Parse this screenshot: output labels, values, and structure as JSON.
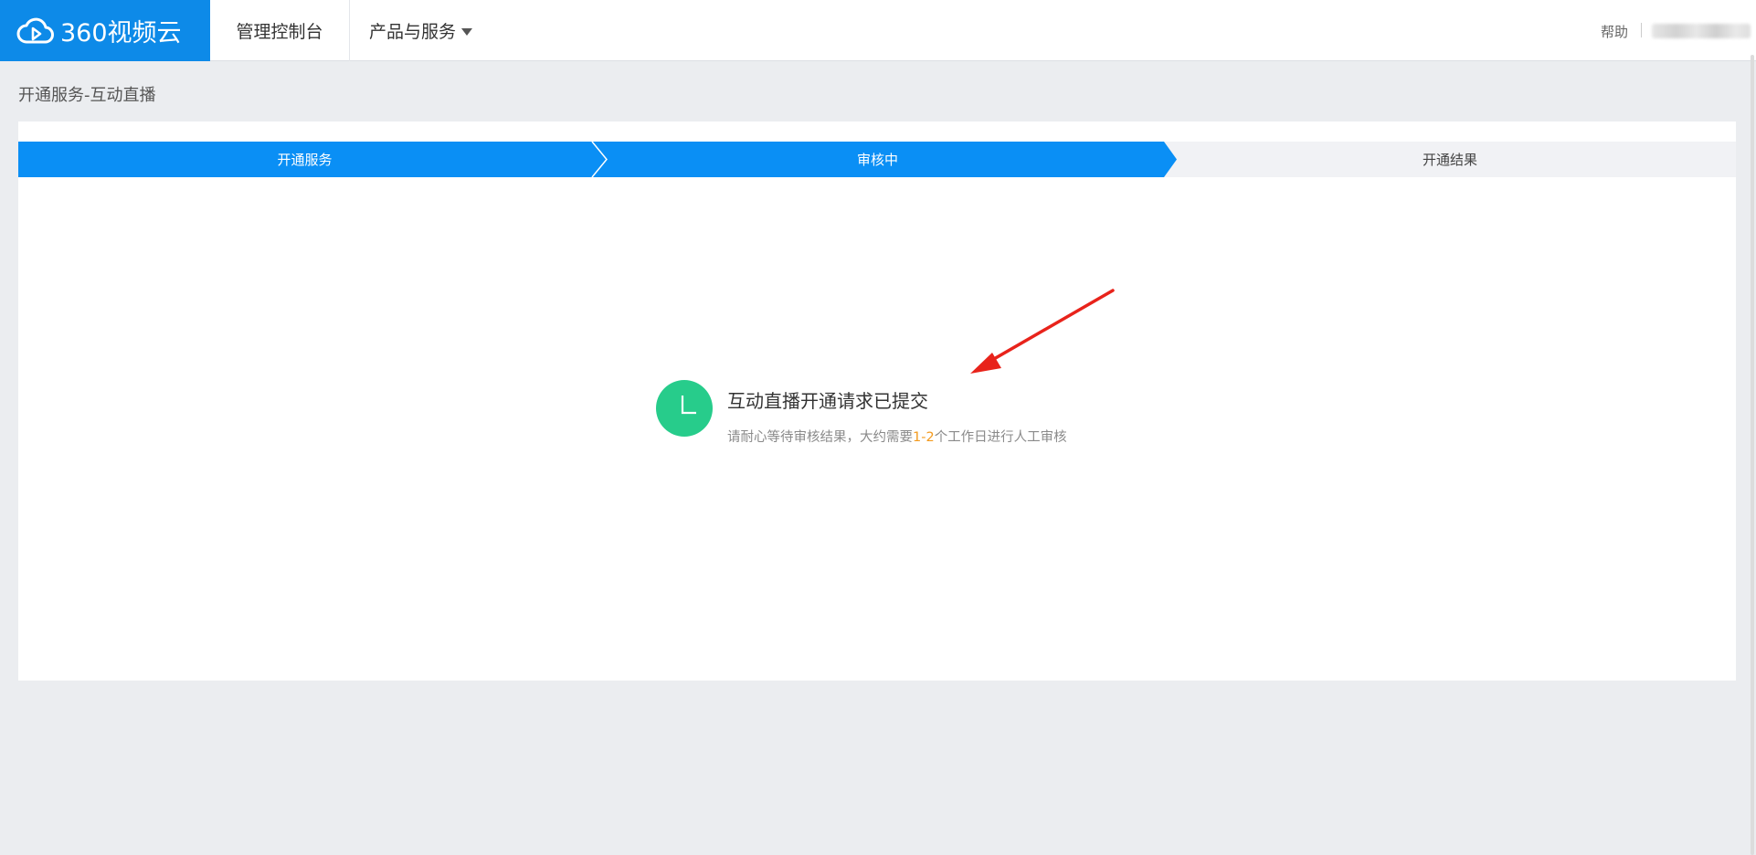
{
  "header": {
    "logo_text": "360视频云",
    "nav": {
      "console": "管理控制台",
      "products": "产品与服务"
    },
    "help": "帮助"
  },
  "breadcrumb": "开通服务-互动直播",
  "steps": [
    {
      "label": "开通服务",
      "state": "done"
    },
    {
      "label": "审核中",
      "state": "active"
    },
    {
      "label": "开通结果",
      "state": "pending"
    }
  ],
  "status": {
    "title": "互动直播开通请求已提交",
    "desc_prefix": "请耐心等待审核结果，大约需要",
    "desc_highlight": "1-2",
    "desc_suffix": "个工作日进行人工审核",
    "icon": "clock-icon"
  },
  "colors": {
    "brand_blue": "#0d8ae8",
    "step_blue": "#0a8ff5",
    "step_inactive": "#f1f2f5",
    "success_green": "#27cc8b",
    "highlight_orange": "#f39a1e",
    "annotation_red": "#e8231b",
    "page_bg": "#ebedf0"
  }
}
